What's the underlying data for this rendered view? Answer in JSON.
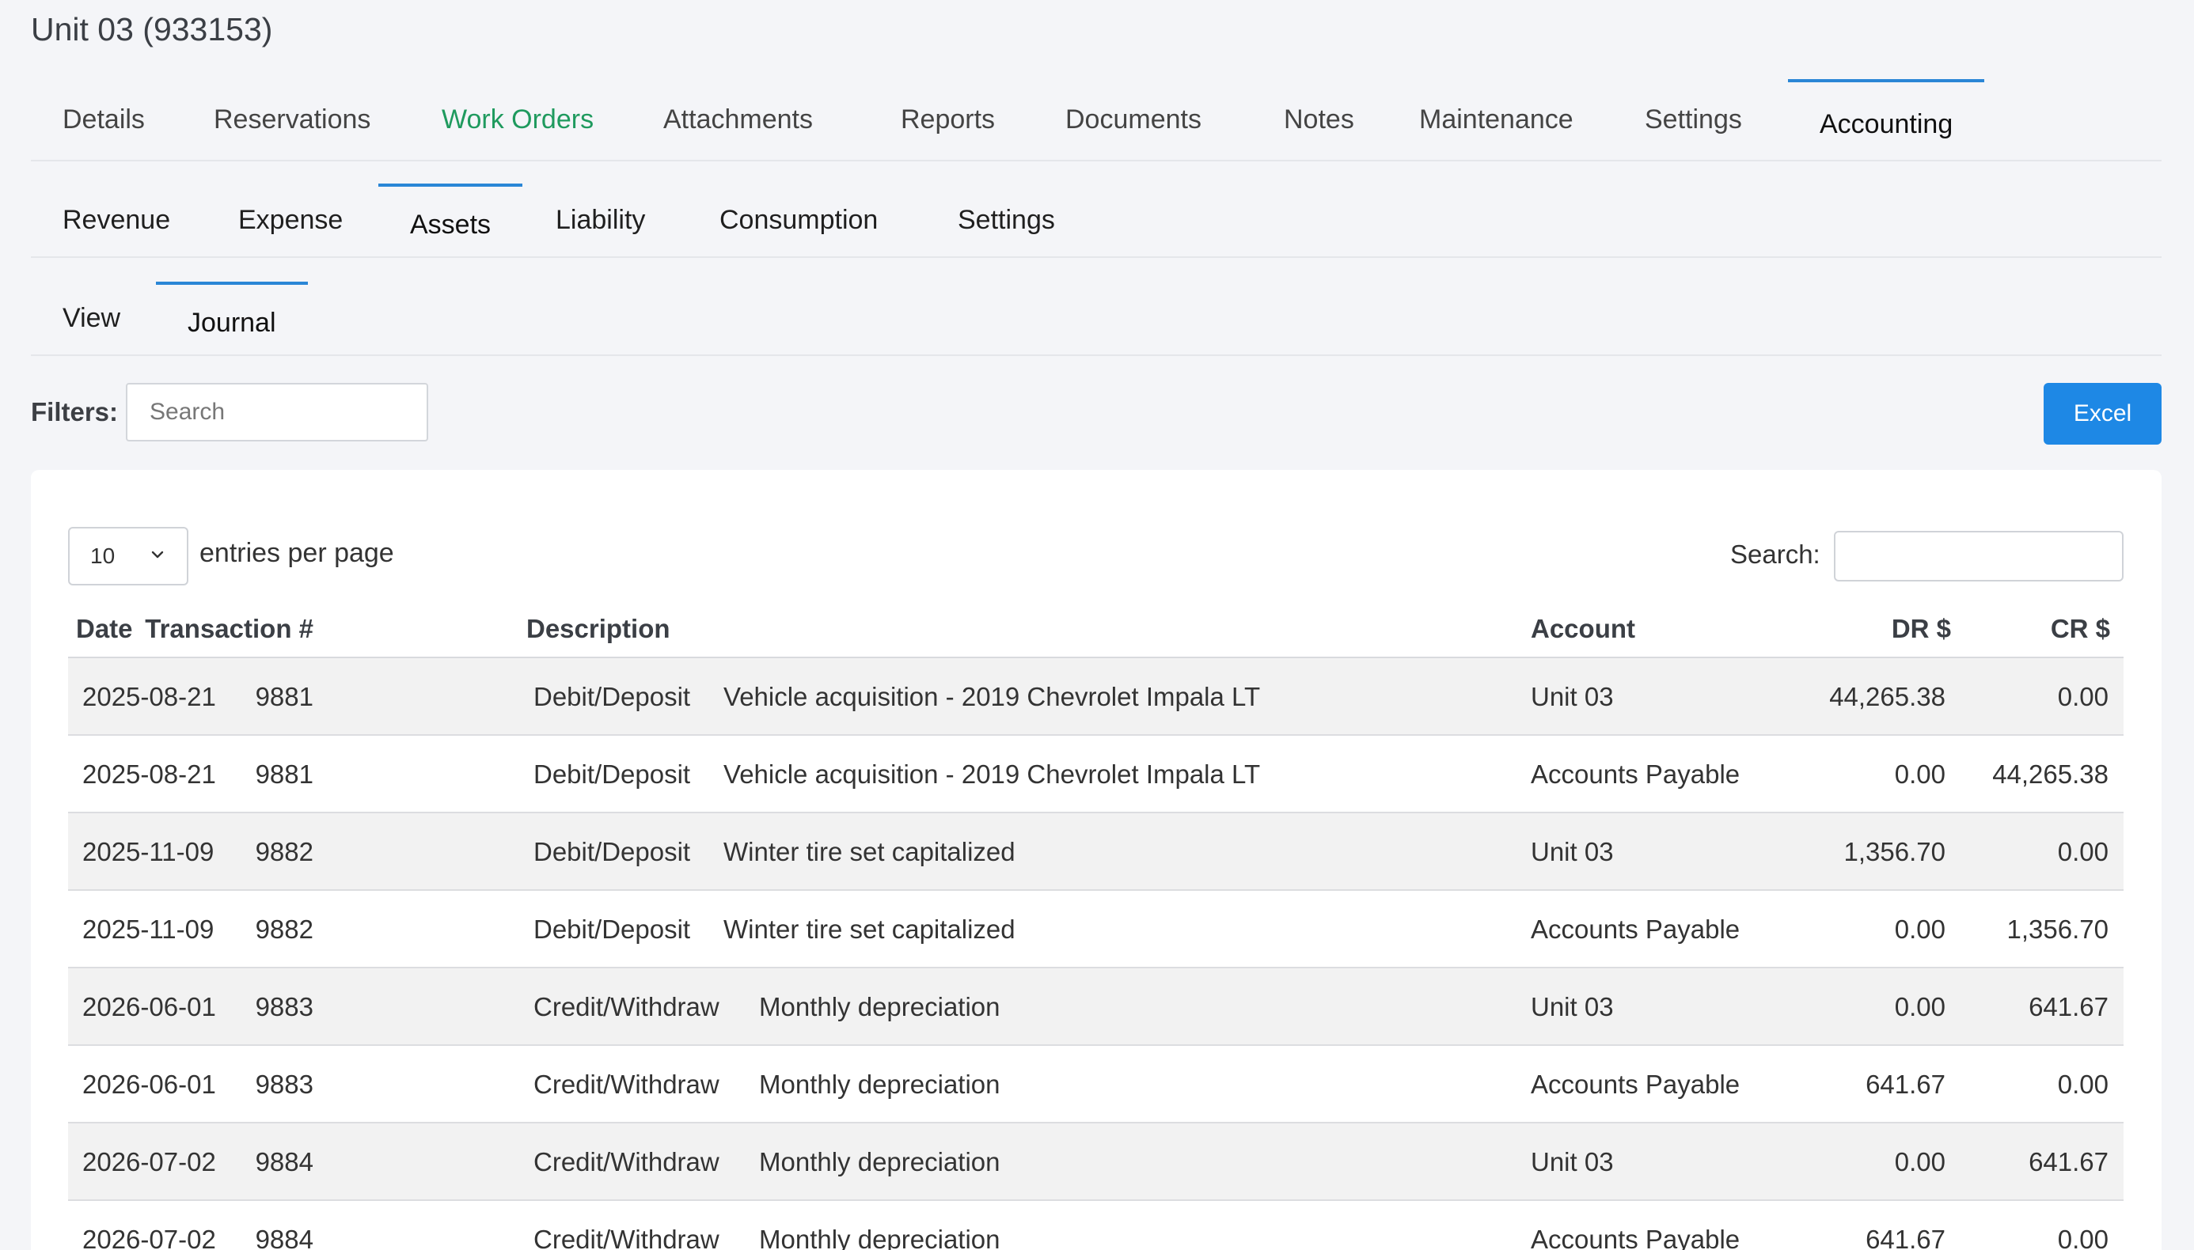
{
  "page": {
    "title": "Unit 03 (933153)"
  },
  "main_tabs": [
    {
      "label": "Details"
    },
    {
      "label": "Reservations"
    },
    {
      "label": "Work Orders"
    },
    {
      "label": "Attachments"
    },
    {
      "label": "Reports"
    },
    {
      "label": "Documents"
    },
    {
      "label": "Notes"
    },
    {
      "label": "Maintenance"
    },
    {
      "label": "Settings"
    },
    {
      "label": "Accounting"
    }
  ],
  "accounting_tabs": [
    {
      "label": "Revenue"
    },
    {
      "label": "Expense"
    },
    {
      "label": "Assets"
    },
    {
      "label": "Liability"
    },
    {
      "label": "Consumption"
    },
    {
      "label": "Settings"
    }
  ],
  "asset_tabs": [
    {
      "label": "View"
    },
    {
      "label": "Journal"
    }
  ],
  "filters": {
    "label": "Filters:",
    "search_placeholder": "Search",
    "excel_label": "Excel"
  },
  "table_controls": {
    "page_length": "10",
    "page_length_label": "entries per page",
    "search_label": "Search:",
    "search_value": ""
  },
  "colors": {
    "accent": "#1e88e5",
    "active_tab_border": "#2a86d6",
    "work_orders_text": "#1f9a5e"
  },
  "journal": {
    "headers": {
      "date": "Date",
      "transaction": "Transaction #",
      "description": "Description",
      "account": "Account",
      "dr": "DR $",
      "cr": "CR $"
    },
    "rows": [
      {
        "date": "2025-08-21",
        "transaction": "9881",
        "type": "Debit/Deposit",
        "description": "Vehicle acquisition - 2019 Chevrolet Impala LT",
        "account": "Unit 03",
        "dr": "44,265.38",
        "cr": "0.00"
      },
      {
        "date": "2025-08-21",
        "transaction": "9881",
        "type": "Debit/Deposit",
        "description": "Vehicle acquisition - 2019 Chevrolet Impala LT",
        "account": "Accounts Payable",
        "dr": "0.00",
        "cr": "44,265.38"
      },
      {
        "date": "2025-11-09",
        "transaction": "9882",
        "type": "Debit/Deposit",
        "description": "Winter tire set capitalized",
        "account": "Unit 03",
        "dr": "1,356.70",
        "cr": "0.00"
      },
      {
        "date": "2025-11-09",
        "transaction": "9882",
        "type": "Debit/Deposit",
        "description": "Winter tire set capitalized",
        "account": "Accounts Payable",
        "dr": "0.00",
        "cr": "1,356.70"
      },
      {
        "date": "2026-06-01",
        "transaction": "9883",
        "type": "Credit/Withdraw",
        "description": "Monthly depreciation",
        "account": "Unit 03",
        "dr": "0.00",
        "cr": "641.67"
      },
      {
        "date": "2026-06-01",
        "transaction": "9883",
        "type": "Credit/Withdraw",
        "description": "Monthly depreciation",
        "account": "Accounts Payable",
        "dr": "641.67",
        "cr": "0.00"
      },
      {
        "date": "2026-07-02",
        "transaction": "9884",
        "type": "Credit/Withdraw",
        "description": "Monthly depreciation",
        "account": "Unit 03",
        "dr": "0.00",
        "cr": "641.67"
      },
      {
        "date": "2026-07-02",
        "transaction": "9884",
        "type": "Credit/Withdraw",
        "description": "Monthly depreciation",
        "account": "Accounts Payable",
        "dr": "641.67",
        "cr": "0.00"
      }
    ]
  }
}
